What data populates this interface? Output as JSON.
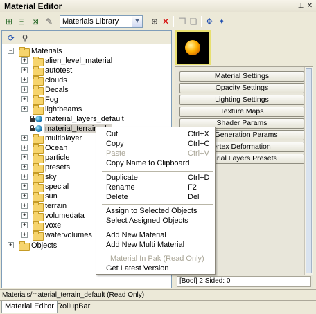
{
  "window": {
    "title": "Material Editor",
    "pin_icon": "pin-icon",
    "close_icon": "close-icon"
  },
  "toolbar": {
    "combo_value": "Materials Library"
  },
  "tree": {
    "root": "Materials",
    "items": [
      "alien_level_material",
      "autotest",
      "clouds",
      "Decals",
      "Fog",
      "lightbeams",
      "material_layers_default",
      "material_terrain_default",
      "multiplayer",
      "Ocean",
      "particle",
      "presets",
      "sky",
      "special",
      "sun",
      "terrain",
      "volumedata",
      "voxel",
      "watervolumes"
    ],
    "selected_label": "material_terrain_de",
    "objects": "Objects"
  },
  "params": {
    "buttons": [
      "Material Settings",
      "Opacity Settings",
      "Lighting Settings",
      "Texture Maps",
      "Shader Params",
      "er Generation Params",
      "ertex Deformation",
      "aterial Layers Presets"
    ],
    "info": "[Bool] 2 Sided: 0"
  },
  "context_menu": {
    "cut": {
      "label": "Cut",
      "shortcut": "Ctrl+X"
    },
    "copy": {
      "label": "Copy",
      "shortcut": "Ctrl+C"
    },
    "paste": {
      "label": "Paste",
      "shortcut": "Ctrl+V"
    },
    "copy_name": {
      "label": "Copy Name to Clipboard"
    },
    "duplicate": {
      "label": "Duplicate",
      "shortcut": "Ctrl+D"
    },
    "rename": {
      "label": "Rename",
      "shortcut": "F2"
    },
    "delete": {
      "label": "Delete",
      "shortcut": "Del"
    },
    "assign": {
      "label": "Assign to Selected Objects"
    },
    "select_assigned": {
      "label": "Select Assigned Objects"
    },
    "add_material": {
      "label": "Add New Material"
    },
    "add_multi": {
      "label": "Add New Multi Material"
    },
    "in_pak": {
      "label": "Material In Pak (Read Only)"
    },
    "latest": {
      "label": "Get Latest Version"
    }
  },
  "status": {
    "text": "Materials/material_terrain_default (Read Only)"
  },
  "tabs": {
    "material_editor": "Material Editor",
    "rollupbar": "RollupBar"
  }
}
